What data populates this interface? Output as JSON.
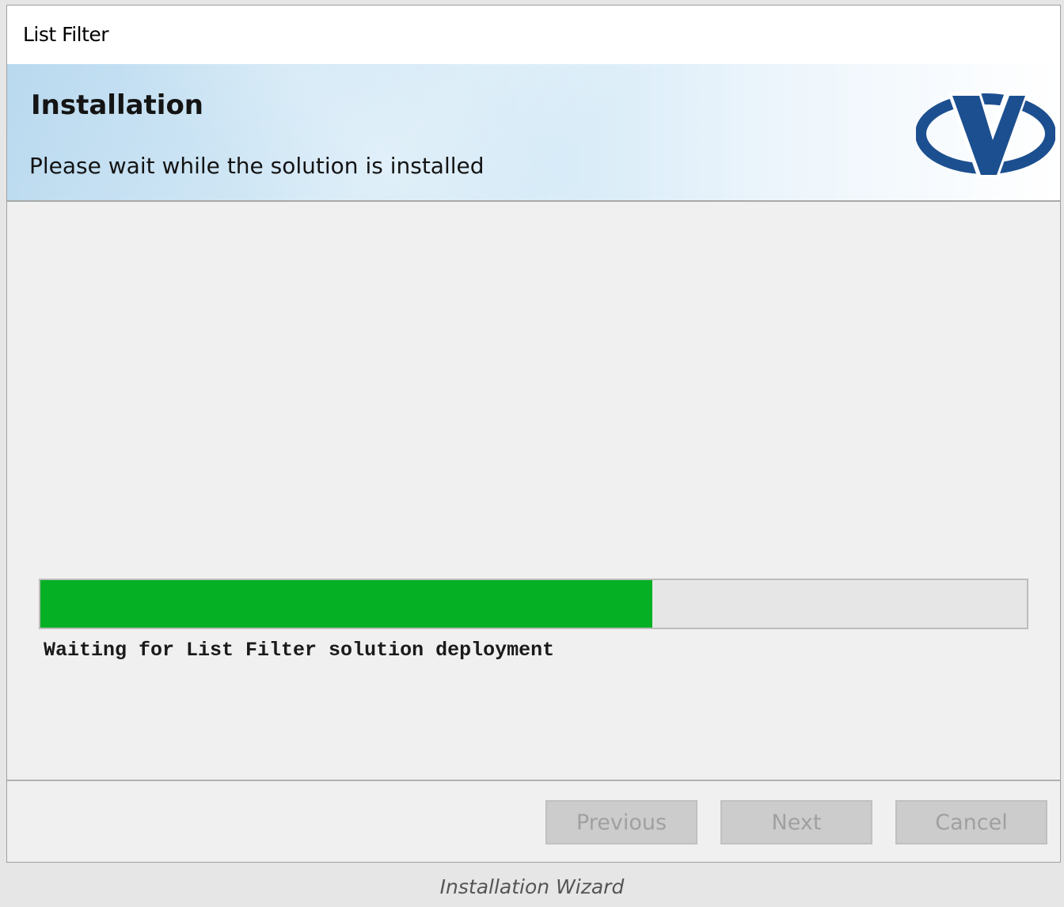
{
  "window": {
    "title": "List Filter"
  },
  "banner": {
    "heading": "Installation",
    "subtitle": "Please wait while the solution is installed",
    "logo_icon": "v-logo-icon"
  },
  "progress": {
    "percent": 62,
    "status": "Waiting for List Filter solution deployment",
    "fill_color": "#06b025"
  },
  "buttons": {
    "previous": "Previous",
    "next": "Next",
    "cancel": "Cancel"
  },
  "caption": "Installation Wizard",
  "colors": {
    "logo_blue": "#1c4f8f",
    "button_disabled_text": "#a0a0a0"
  }
}
